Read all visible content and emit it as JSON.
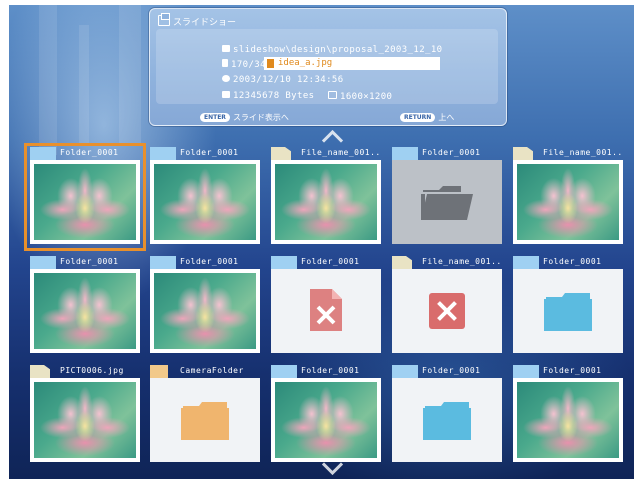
{
  "panel": {
    "title": "スライドショー",
    "path": "slideshow\\design\\proposal_2003_12_10",
    "counter": "170/345",
    "file_name": "idea_a.jpg",
    "datetime": "2003/12/10 12:34:56",
    "size": "12345678 Bytes",
    "resolution": "1600×1200",
    "enter_key": "ENTER",
    "enter_text": "スライド表示へ",
    "return_key": "RETURN",
    "return_text": "上へ"
  },
  "grid": {
    "items": [
      {
        "label": "Folder_0001",
        "kind": "folder",
        "thumb": "photo",
        "selected": true
      },
      {
        "label": "Folder_0001",
        "kind": "folder",
        "thumb": "photo"
      },
      {
        "label": "File_name_001...",
        "kind": "file",
        "thumb": "photo"
      },
      {
        "label": "Folder_0001",
        "kind": "folder",
        "thumb": "gray-folder"
      },
      {
        "label": "File_name_001...",
        "kind": "file",
        "thumb": "photo"
      },
      {
        "label": "Folder_0001",
        "kind": "folder",
        "thumb": "photo"
      },
      {
        "label": "Folder_0001",
        "kind": "folder",
        "thumb": "photo"
      },
      {
        "label": "Folder_0001",
        "kind": "folder",
        "thumb": "broken-file"
      },
      {
        "label": "File_name_001...",
        "kind": "file",
        "thumb": "error-x"
      },
      {
        "label": "Folder_0001",
        "kind": "folder",
        "thumb": "blue-folder"
      },
      {
        "label": "PICT0006.jpg",
        "kind": "file",
        "thumb": "photo"
      },
      {
        "label": "CameraFolder",
        "kind": "camera-folder",
        "thumb": "orange-folder"
      },
      {
        "label": "Folder_0001",
        "kind": "folder",
        "thumb": "photo"
      },
      {
        "label": "Folder_0001",
        "kind": "folder",
        "thumb": "blue-folder"
      },
      {
        "label": "Folder_0001",
        "kind": "folder",
        "thumb": "photo"
      }
    ]
  },
  "colors": {
    "selection": "#e8902c",
    "folder_blue": "#5bbbe0",
    "folder_orange": "#f0b56e",
    "error_red": "#d96c6c"
  }
}
